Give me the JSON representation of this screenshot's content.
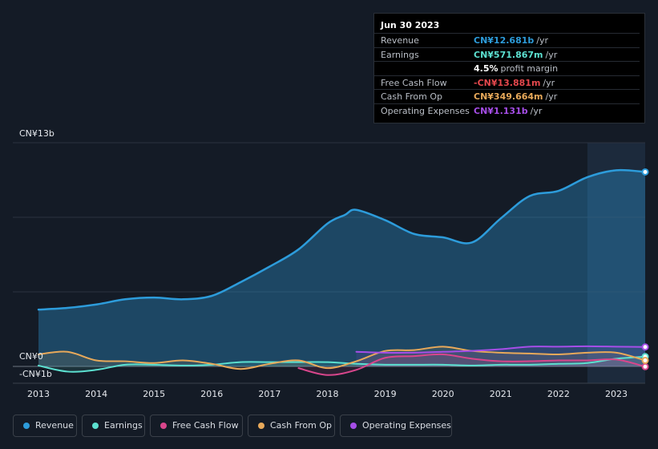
{
  "chart_data": {
    "type": "area",
    "y_axis": {
      "top_label": "CN¥13b",
      "zero_label": "CN¥0",
      "neg_label": "-CN¥1b",
      "ylim": [
        -1.0,
        13.0
      ]
    },
    "x_ticks": [
      "2013",
      "2014",
      "2015",
      "2016",
      "2017",
      "2018",
      "2019",
      "2020",
      "2021",
      "2022",
      "2023"
    ],
    "series": [
      {
        "name": "Revenue",
        "color": "#2d9cdb",
        "x": [
          2013.0,
          2013.5,
          2014.0,
          2014.5,
          2015.0,
          2015.5,
          2016.0,
          2016.5,
          2017.0,
          2017.5,
          2018.0,
          2018.3,
          2018.5,
          2019.0,
          2019.5,
          2020.0,
          2020.5,
          2021.0,
          2021.5,
          2022.0,
          2022.5,
          2023.0,
          2023.5
        ],
        "values": [
          3.3,
          3.4,
          3.6,
          3.9,
          4.0,
          3.9,
          4.1,
          4.9,
          5.8,
          6.8,
          8.3,
          8.8,
          9.1,
          8.5,
          7.7,
          7.5,
          7.2,
          8.6,
          9.9,
          10.2,
          11.0,
          11.4,
          11.3
        ]
      },
      {
        "name": "Earnings",
        "color": "#5ce0d0",
        "x": [
          2013.0,
          2013.5,
          2014.0,
          2014.5,
          2015.0,
          2015.5,
          2016.0,
          2016.5,
          2017.0,
          2017.5,
          2018.0,
          2018.5,
          2019.0,
          2019.5,
          2020.0,
          2020.5,
          2021.0,
          2021.5,
          2022.0,
          2022.5,
          2023.0,
          2023.5
        ],
        "values": [
          0.05,
          -0.3,
          -0.2,
          0.1,
          0.1,
          0.05,
          0.1,
          0.25,
          0.25,
          0.25,
          0.25,
          0.15,
          0.1,
          0.1,
          0.1,
          0.05,
          0.1,
          0.1,
          0.15,
          0.2,
          0.45,
          0.57
        ]
      },
      {
        "name": "Free Cash Flow",
        "color": "#d9468c",
        "x": [
          2017.5,
          2018.0,
          2018.5,
          2019.0,
          2019.5,
          2020.0,
          2020.5,
          2021.0,
          2021.5,
          2022.0,
          2022.5,
          2023.0,
          2023.5
        ],
        "values": [
          -0.1,
          -0.5,
          -0.2,
          0.5,
          0.6,
          0.7,
          0.45,
          0.3,
          0.3,
          0.35,
          0.35,
          0.4,
          -0.014
        ]
      },
      {
        "name": "Cash From Op",
        "color": "#e8a95a",
        "x": [
          2013.0,
          2013.5,
          2014.0,
          2014.5,
          2015.0,
          2015.5,
          2016.0,
          2016.5,
          2017.0,
          2017.5,
          2018.0,
          2018.5,
          2019.0,
          2019.5,
          2020.0,
          2020.5,
          2021.0,
          2021.5,
          2022.0,
          2022.5,
          2023.0,
          2023.5
        ],
        "values": [
          0.7,
          0.85,
          0.35,
          0.3,
          0.2,
          0.35,
          0.15,
          -0.15,
          0.15,
          0.35,
          -0.1,
          0.3,
          0.9,
          0.95,
          1.15,
          0.9,
          0.8,
          0.75,
          0.7,
          0.8,
          0.8,
          0.35
        ]
      },
      {
        "name": "Operating Expenses",
        "color": "#a64ee8",
        "x": [
          2018.5,
          2019.0,
          2019.5,
          2020.0,
          2020.5,
          2021.0,
          2021.5,
          2022.0,
          2022.5,
          2023.0,
          2023.5
        ],
        "values": [
          0.85,
          0.8,
          0.8,
          0.85,
          0.9,
          1.0,
          1.15,
          1.15,
          1.17,
          1.15,
          1.13
        ]
      }
    ],
    "highlight_from": 2022.5,
    "grid": true
  },
  "tooltip": {
    "date": "Jun 30 2023",
    "rows": [
      {
        "label": "Revenue",
        "value": "CN¥12.681b",
        "unit": "/yr",
        "color": "#2d9cdb"
      },
      {
        "label": "Earnings",
        "value": "CN¥571.867m",
        "unit": "/yr",
        "color": "#5ce0d0"
      },
      {
        "label": "",
        "value": "4.5%",
        "unit": "profit margin",
        "color": "#ffffff"
      },
      {
        "label": "Free Cash Flow",
        "value": "-CN¥13.881m",
        "unit": "/yr",
        "color": "#e5484d"
      },
      {
        "label": "Cash From Op",
        "value": "CN¥349.664m",
        "unit": "/yr",
        "color": "#e8a95a"
      },
      {
        "label": "Operating Expenses",
        "value": "CN¥1.131b",
        "unit": "/yr",
        "color": "#a64ee8"
      }
    ]
  },
  "legend": [
    {
      "label": "Revenue",
      "color": "#2d9cdb"
    },
    {
      "label": "Earnings",
      "color": "#5ce0d0"
    },
    {
      "label": "Free Cash Flow",
      "color": "#d9468c"
    },
    {
      "label": "Cash From Op",
      "color": "#e8a95a"
    },
    {
      "label": "Operating Expenses",
      "color": "#a64ee8"
    }
  ]
}
